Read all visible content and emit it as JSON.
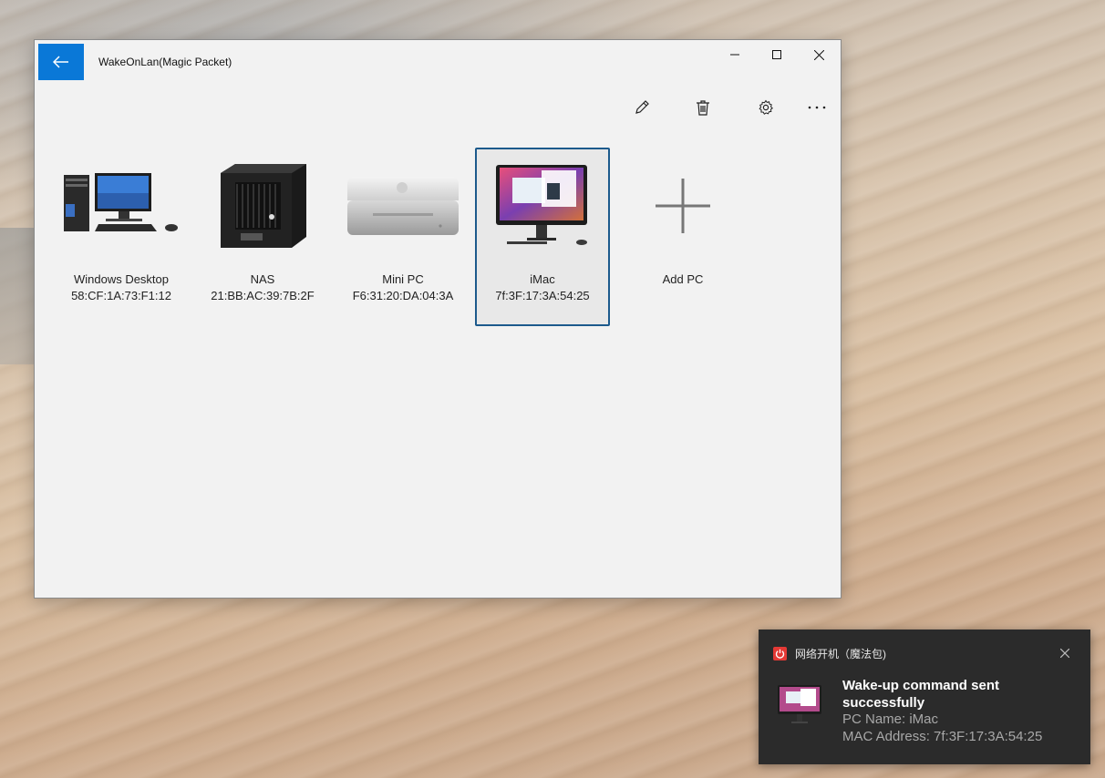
{
  "window": {
    "title": "WakeOnLan(Magic Packet)",
    "accent": "#0a78d7"
  },
  "toolbar": {
    "edit_icon": "pencil-icon",
    "delete_icon": "trash-icon",
    "settings_icon": "gear-icon",
    "more_icon": "more-icon"
  },
  "devices": [
    {
      "name": "Windows Desktop",
      "mac": "58:CF:1A:73:F1:12",
      "icon": "desktop-pc-icon"
    },
    {
      "name": "NAS",
      "mac": "21:BB:AC:39:7B:2F",
      "icon": "nas-icon"
    },
    {
      "name": "Mini PC",
      "mac": "F6:31:20:DA:04:3A",
      "icon": "mini-pc-icon"
    },
    {
      "name": "iMac",
      "mac": "7f:3F:17:3A:54:25",
      "icon": "imac-icon",
      "selected": true
    }
  ],
  "add_tile": {
    "label": "Add PC",
    "icon": "plus-icon"
  },
  "toast": {
    "app_name": "网络开机（魔法包)",
    "heading": "Wake-up command sent successfully",
    "pc_name_line": "PC Name: iMac",
    "mac_line": "MAC Address: 7f:3F:17:3A:54:25"
  }
}
